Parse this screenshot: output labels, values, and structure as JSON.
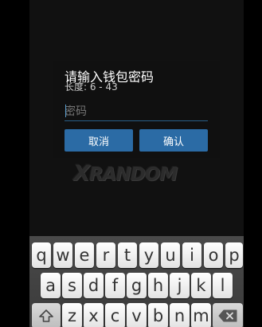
{
  "watermark": {
    "text": "XRANDOM",
    "first": "X",
    "rest": "RANDOM"
  },
  "dialog": {
    "title": "请输入钱包密码",
    "hint": "长度: 6 - 43",
    "password_placeholder": "密码",
    "cancel_label": "取消",
    "confirm_label": "确认"
  },
  "keyboard": {
    "row1": [
      "q",
      "w",
      "e",
      "r",
      "t",
      "y",
      "u",
      "i",
      "o",
      "p"
    ],
    "row2": [
      "a",
      "s",
      "d",
      "f",
      "g",
      "h",
      "j",
      "k",
      "l"
    ],
    "row3": [
      "z",
      "x",
      "c",
      "v",
      "b",
      "n",
      "m"
    ],
    "shift_icon": "shift-arrow-icon",
    "backspace_icon": "backspace-icon"
  },
  "colors": {
    "button": "#2b6ba5",
    "underline": "#2a5f86",
    "key": "#ffffff"
  }
}
